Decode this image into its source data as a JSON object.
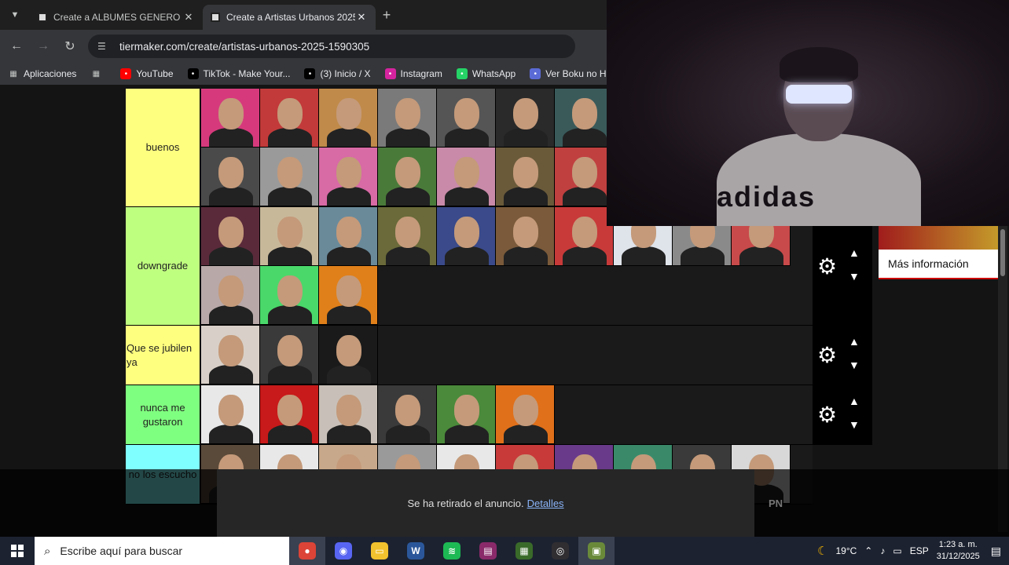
{
  "browser": {
    "tabs": [
      {
        "title": "Create a ALBUMES GENERO UR",
        "active": false
      },
      {
        "title": "Create a Artistas Urbanos 2025",
        "active": true
      }
    ],
    "url": "tiermaker.com/create/artistas-urbanos-2025-1590305",
    "bookmarks": [
      {
        "label": "Aplicaciones",
        "icon": "apps-grid-icon"
      },
      {
        "label": "",
        "icon": "grid-icon"
      },
      {
        "label": "YouTube",
        "icon": "youtube-icon",
        "color": "#ff0000"
      },
      {
        "label": "TikTok - Make Your...",
        "icon": "tiktok-icon",
        "color": "#000000"
      },
      {
        "label": "(3) Inicio / X",
        "icon": "x-icon",
        "color": "#000000"
      },
      {
        "label": "Instagram",
        "icon": "instagram-icon",
        "color": "#d6249f"
      },
      {
        "label": "WhatsApp",
        "icon": "whatsapp-icon",
        "color": "#25d366"
      },
      {
        "label": "Ver Boku no Hero A...",
        "icon": "anime-icon",
        "color": "#5b6bd6"
      }
    ]
  },
  "tiers": [
    {
      "label": "buenos",
      "color": "#ffff7f",
      "rows": 2
    },
    {
      "label": "downgrade",
      "color": "#bfff7f",
      "rows": 2
    },
    {
      "label": "Que se jubilen ya",
      "color": "#ffff7f",
      "rows": 1
    },
    {
      "label": "nunca me gustaron",
      "color": "#7fff7f",
      "rows": 1
    },
    {
      "label": "no los escucho",
      "color": "#7fffff",
      "rows": 1
    }
  ],
  "ad": {
    "label": "Más información"
  },
  "ad_removed": {
    "text": "Se ha retirado el anuncio.",
    "link": "Detalles"
  },
  "overlay_text": "PN",
  "webcam": {
    "shirt_logo": "adidas"
  },
  "taskbar": {
    "search_placeholder": "Escribe aquí para buscar",
    "apps": [
      "chrome-icon",
      "discord-icon",
      "file-explorer-icon",
      "word-icon",
      "spotify-icon",
      "winrar-icon",
      "minecraft-launcher-icon",
      "obs-icon",
      "minecraft-icon"
    ],
    "weather": "19°C",
    "language": "ESP",
    "time": "1:23 a. m.",
    "date": "31/12/2025"
  },
  "colors": {
    "accent": "#8ab4f8",
    "tier_yellow": "#ffff7f",
    "tier_green": "#7fff7f"
  }
}
